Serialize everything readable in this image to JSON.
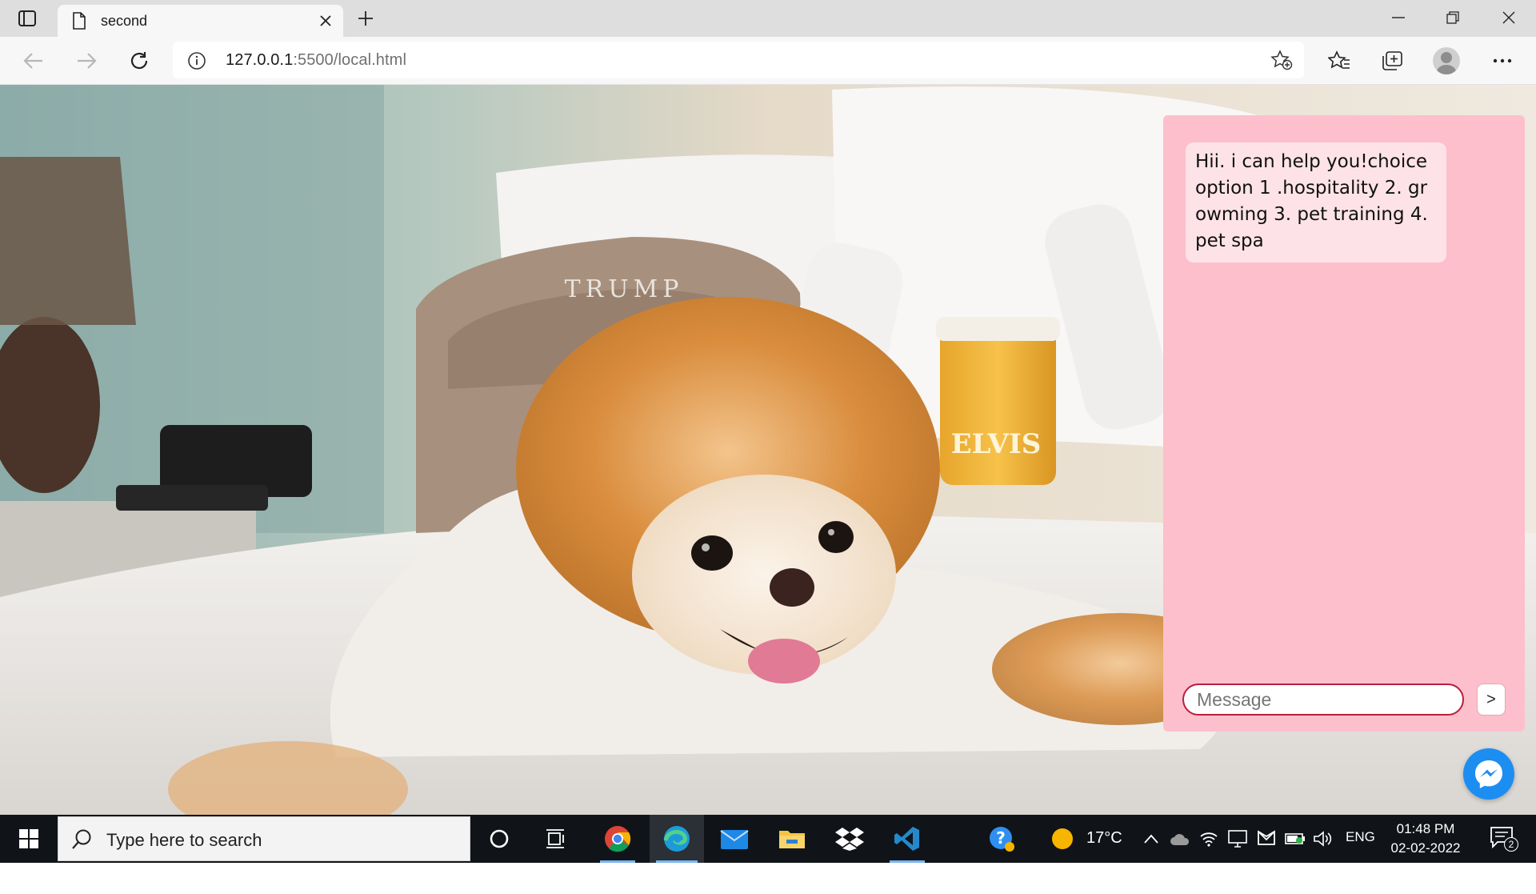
{
  "browser": {
    "tab_title": "second",
    "url_host": "127.0.0.1",
    "url_path": ":5500/local.html"
  },
  "chat": {
    "bot_message": "Hii. i can help you!choice option 1 .hospitality 2. growming 3. pet training 4. pet spa",
    "input_placeholder": "Message",
    "send_label": ">"
  },
  "taskbar": {
    "search_placeholder": "Type here to search",
    "weather_temp": "17°C",
    "language": "ENG",
    "time": "01:48 PM",
    "date": "02-02-2022",
    "notification_count": "2"
  },
  "photo_labels": {
    "pillow_brand": "TRUMP",
    "jar_label": "ELVIS"
  },
  "colors": {
    "chat_panel_bg": "#fdbfcb",
    "bubble_bg": "#fde3e7",
    "input_border": "#b81f3d",
    "messenger_blue": "#1c8ef2",
    "taskbar_bg": "#101418"
  }
}
